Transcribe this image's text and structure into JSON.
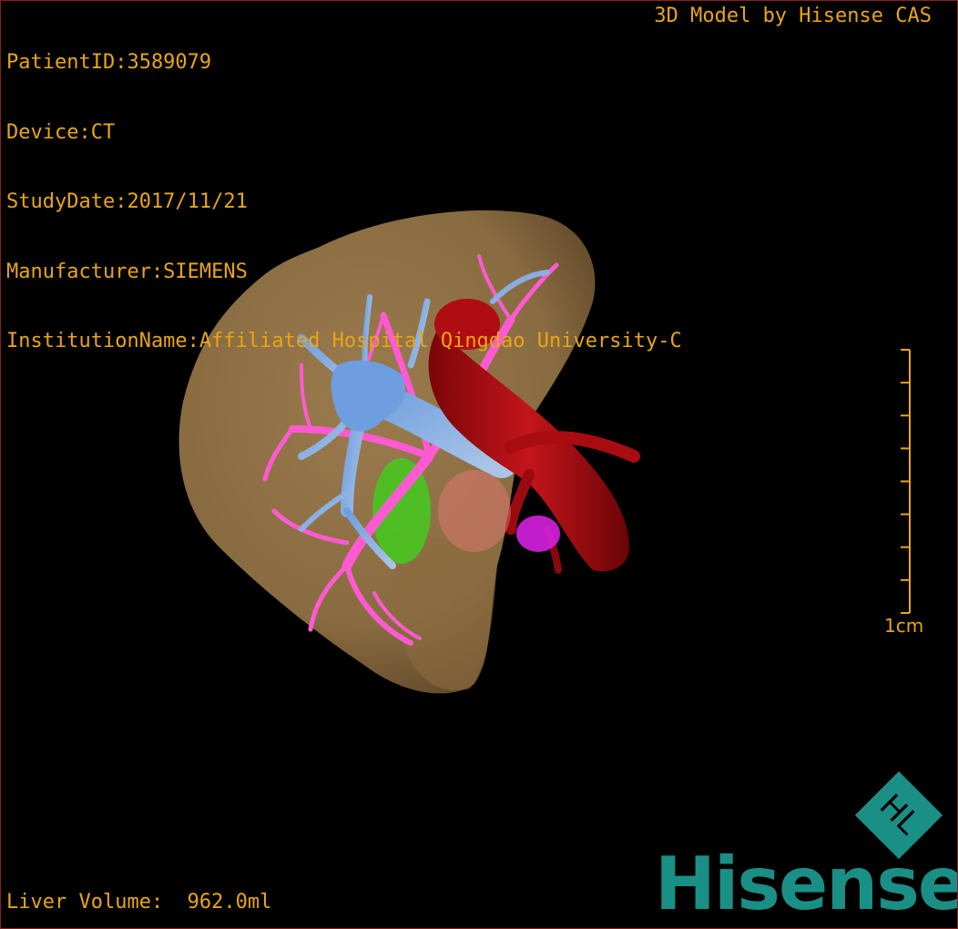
{
  "study_info": {
    "patient_id": "PatientID:3589079",
    "device": "Device:CT",
    "study_date": "StudyDate:2017/11/21",
    "manufacturer": "Manufacturer:SIEMENS",
    "institution": "InstitutionName:Affiliated Hospital Qingdao University-C"
  },
  "credit": "3D Model by Hisense CAS",
  "measurement": {
    "liver_volume": "Liver Volume:  962.0ml"
  },
  "scale_bar": {
    "label": "1cm",
    "ticks": 9
  },
  "brand": {
    "wordmark": "Hisense",
    "logo_icon": "hl-diamond-logo-icon",
    "logo_text": "HL"
  },
  "colors": {
    "overlay_text": "#e8a615",
    "brand_teal": "#1a8f86",
    "liver": "#9c7a4a",
    "portal_vein": "#8fb4e0",
    "hepatic_vein": "#ff5ad2",
    "ivc": "#b00d12",
    "gallbladder": "#3ecf1c",
    "border": "#8a1e1e"
  }
}
